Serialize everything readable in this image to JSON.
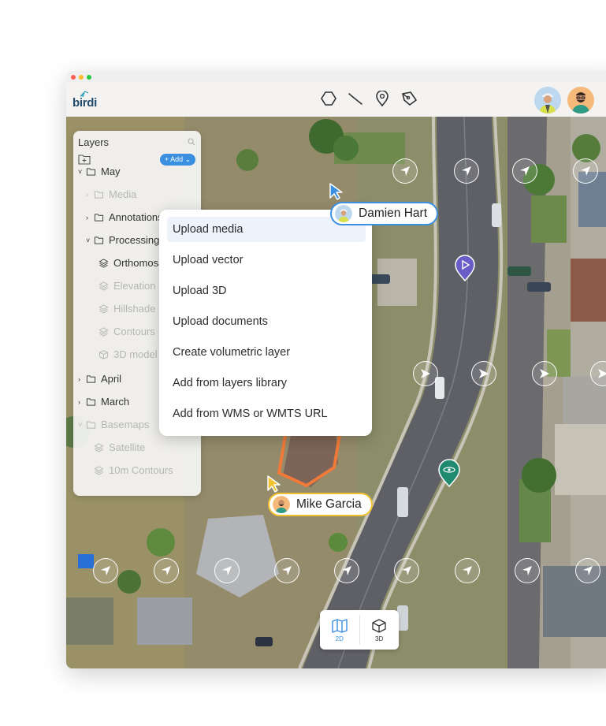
{
  "app": {
    "logo_text": "birdi"
  },
  "toolbar": {
    "tools": [
      "polygon-icon",
      "line-icon",
      "location-pin-icon",
      "pen-icon"
    ],
    "avatars": [
      "avatar-damien",
      "avatar-mike"
    ]
  },
  "layers_panel": {
    "title": "Layers",
    "add_label": "+ Add ⌄",
    "items": [
      {
        "label": "May",
        "level": 0,
        "chevron": "˅",
        "icon": "folder",
        "dim": false
      },
      {
        "label": "Media",
        "level": 1,
        "chevron": "›",
        "icon": "folder",
        "dim": true
      },
      {
        "label": "Annotations",
        "level": 1,
        "chevron": "›",
        "icon": "folder",
        "dim": false
      },
      {
        "label": "Processing",
        "level": 1,
        "chevron": "˅",
        "icon": "folder",
        "dim": false
      },
      {
        "label": "Orthomosaic",
        "level": 2,
        "chevron": "",
        "icon": "layers",
        "dim": false
      },
      {
        "label": "Elevation",
        "level": 2,
        "chevron": "",
        "icon": "layers",
        "dim": true
      },
      {
        "label": "Hillshade",
        "level": 2,
        "chevron": "",
        "icon": "layers",
        "dim": true
      },
      {
        "label": "Contours",
        "level": 2,
        "chevron": "",
        "icon": "layers",
        "dim": true
      },
      {
        "label": "3D model",
        "level": 2,
        "chevron": "",
        "icon": "cube",
        "dim": true
      },
      {
        "label": "April",
        "level": 0,
        "chevron": "›",
        "icon": "folder",
        "dim": false
      },
      {
        "label": "March",
        "level": 0,
        "chevron": "›",
        "icon": "folder",
        "dim": false
      },
      {
        "label": "Basemaps",
        "level": 0,
        "chevron": "˅",
        "icon": "folder",
        "dim": true
      },
      {
        "label": "Satellite",
        "level": 1,
        "chevron": "",
        "icon": "layers",
        "dim": true
      },
      {
        "label": "10m Contours",
        "level": 1,
        "chevron": "",
        "icon": "layers",
        "dim": true
      }
    ]
  },
  "add_menu": {
    "items": [
      "Upload media",
      "Upload vector",
      "Upload 3D",
      "Upload documents",
      "Create volumetric layer",
      "Add from layers library",
      "Add from WMS or WMTS URL"
    ],
    "active_index": 0
  },
  "collaborators": [
    {
      "name": "Damien Hart",
      "color": "#3a8fe0"
    },
    {
      "name": "Mike Garcia",
      "color": "#f2c230"
    }
  ],
  "view_switch": {
    "options": [
      "2D",
      "3D"
    ],
    "active": "2D"
  },
  "colors": {
    "accent": "#3a8fe0",
    "highlight_outline": "#f07a3a",
    "cursor_yellow": "#f2c230",
    "pin_purple": "#6a5cc7",
    "pin_green": "#1f8a70"
  }
}
